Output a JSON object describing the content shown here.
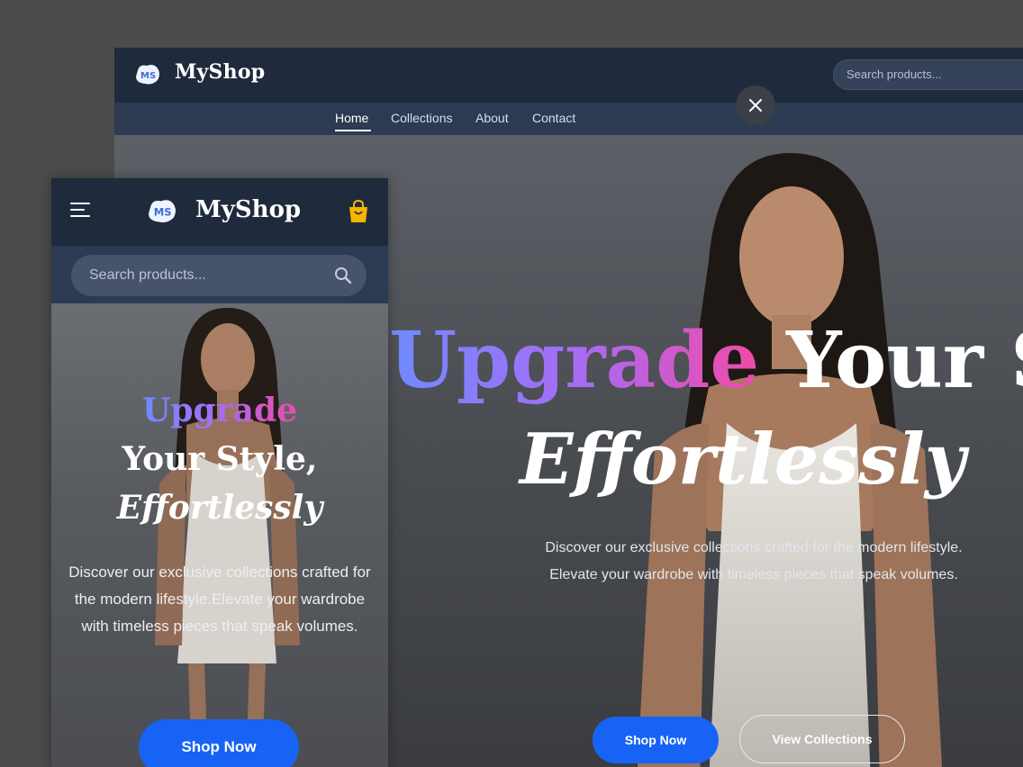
{
  "desktop": {
    "brand": "MyShop",
    "search_placeholder": "Search products...",
    "nav": [
      "Home",
      "Collections",
      "About",
      "Contact"
    ],
    "active_nav": "Home",
    "hero": {
      "title_gradient": "Upgrade",
      "title_rest": " Your Sty",
      "title_line2": "Effortlessly",
      "desc_line1": "Discover our exclusive collections crafted for the modern lifestyle.",
      "desc_line2": "Elevate your wardrobe with timeless pieces that speak volumes."
    },
    "shop_now": "Shop Now",
    "view_collections": "View Collections"
  },
  "mobile": {
    "brand": "MyShop",
    "search_placeholder": "Search products...",
    "hero": {
      "title_gradient": "Upgrade",
      "title_line2": "Your Style,",
      "title_line3": "Effortlessly",
      "desc": "Discover our exclusive collections crafted for the modern lifestyle.Elevate your wardrobe with timeless pieces that speak volumes."
    },
    "shop_now": "Shop Now"
  },
  "colors": {
    "header": "#1f2a3d",
    "nav_bar": "#2c3a52",
    "primary_button": "#1763f5",
    "gradient_start": "#6f8bff",
    "gradient_end": "#f04aa7",
    "cart_icon": "#f5b400"
  },
  "icons": [
    "logo-icon",
    "close-icon",
    "menu-icon",
    "shopping-bag-icon",
    "search-icon"
  ]
}
